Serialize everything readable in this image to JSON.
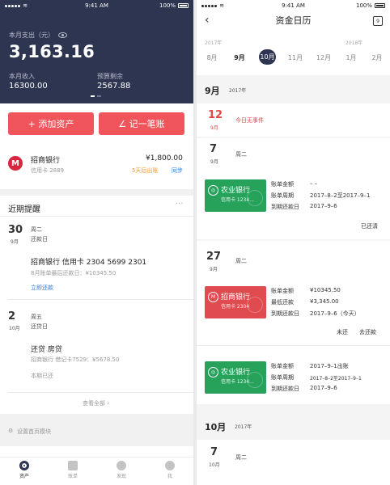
{
  "status": {
    "time": "9:41 AM",
    "battery": "100%"
  },
  "left": {
    "hero": {
      "spend_label": "本月支出（元）",
      "spend": "3,163.16",
      "income_label": "本月收入",
      "income": "16300.00",
      "budget_label": "预算剩余",
      "budget": "2567.88"
    },
    "actions": {
      "add_asset": "+ 添加资产",
      "add_bill": "∠ 记一笔账"
    },
    "bank": {
      "name": "招商银行",
      "card": "信用卡 2889",
      "amount": "¥1,800.00",
      "due": "5天后出账",
      "sync": "同步"
    },
    "reminders": {
      "title": "近期提醒",
      "more": "···",
      "items": [
        {
          "day": "30",
          "month": "9月",
          "weekday": "周二",
          "kind": "还款日",
          "title": "招商银行   信用卡 2304 5699 2301",
          "detail": "8月账单最后还款日：¥10345.50",
          "action": "立即还款"
        },
        {
          "day": "2",
          "month": "10月",
          "weekday": "周五",
          "kind": "还贷日",
          "title": "还贷    房贷",
          "detail": "招商银行 借记卡7529：¥5678.50",
          "action": "本期已还"
        }
      ],
      "view_all": "查看全部 ›"
    },
    "settings": "设置首页模块",
    "tabs": [
      "资产",
      "账单",
      "发现",
      "我"
    ]
  },
  "right": {
    "title": "资金日历",
    "calendar_icon": "9",
    "years": [
      "2017年",
      "2018年"
    ],
    "months": [
      "8月",
      "9月",
      "10月",
      "11月",
      "12月",
      "1月",
      "2月"
    ],
    "sections": [
      {
        "month": "9月",
        "year": "2017年"
      },
      {
        "month": "10月",
        "year": "2017年"
      }
    ],
    "today": {
      "day": "12",
      "month": "9月",
      "text": "今日无事件"
    },
    "day7": {
      "day": "7",
      "month": "9月",
      "weekday": "周二"
    },
    "bill1": {
      "bank": "农业银行",
      "card": "信用卡 1234...",
      "k1": "账单金额",
      "v1": "– –",
      "k2": "账单周期",
      "v2": "2017–8–2至2017–9–1",
      "k3": "到期还款日",
      "v3": "2017–9–6",
      "status": "已还清"
    },
    "day27": {
      "day": "27",
      "month": "9月",
      "weekday": "周二"
    },
    "bill2": {
      "bank": "招商银行",
      "card": "信用卡 2304",
      "k1": "账单金额",
      "v1": "¥10345.50",
      "k2": "最低还款",
      "v2": "¥3,345.00",
      "k3": "到期还款日",
      "v3": "2017–9–6（今天）",
      "status": "未还",
      "action": "去还款"
    },
    "bill3": {
      "bank": "农业银行",
      "card": "信用卡 1234...",
      "k1": "账单金额",
      "v1": "2017–9–1出账",
      "v1b": "2017–8–2至2017–9–1",
      "k2": "账单周期",
      "k3": "到期还款日",
      "v3": "2017–9–6"
    },
    "day7b": {
      "day": "7",
      "month": "10月",
      "weekday": "周二"
    }
  },
  "colors": {
    "navy": "#2d3550",
    "accent": "#f0555b",
    "green": "#26a25b",
    "red": "#e04b50",
    "blue": "#2f7bd9",
    "orange": "#f09a36"
  }
}
